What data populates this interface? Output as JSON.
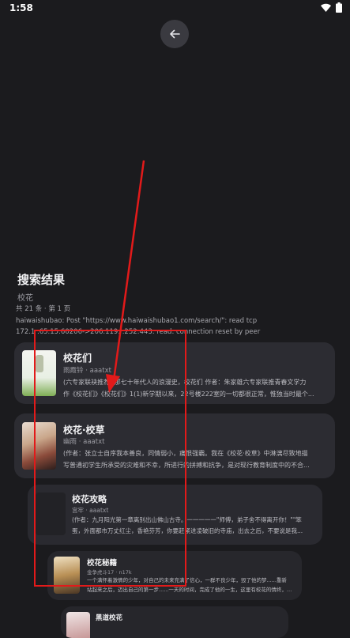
{
  "status": {
    "time": "1:58"
  },
  "header": {
    "title": "搜索结果",
    "keyword": "校花"
  },
  "meta": "共 21 条 · 第 1 页",
  "error_lines": [
    "haiwaishubao: Post \"https://www.haiwaishubao1.com/search/\": read tcp",
    "172.1  .65.15:60206->206.119.  .252:443: read: connection reset by peer"
  ],
  "results": [
    {
      "title": "校花们",
      "author": "雨霞铃 · aaatxt",
      "desc": [
        "(六专家联袂推荐) 那七十年代人的浪漫史，校花们 作者：朱家雄六专家联推青春文学力",
        "作《校花们》《校花们》1(1)新学期以来，22号楼222室的一切都很正常，惟独当时最个..."
      ]
    },
    {
      "title": "校花·校草",
      "author": "幽雨 · aaatxt",
      "desc": [
        "(作者：张立士自序我本善良，同情弱小，痛恨强霸。我在《校花·校草》中淋漓尽致地描",
        "写普通初学生所承受的灾难和不幸，所进行的拼搏和抗争，是对现行教育制度中的不合..."
      ]
    },
    {
      "title": "校花攻略",
      "author": "宫牢 · aaatxt",
      "desc": [
        "(作者：九月阳光第一章离别出山佛山古寺。一一一一一\"师傅，弟子舍不得离开你！\"\"笨",
        "蛋，外面都市万丈红尘，香艳芬芳，你要赶紧进凌破旧的寺庙，出去之后，不要说是我..."
      ]
    },
    {
      "title": "校花秘籍",
      "author": "金争虎斗17 · n17k",
      "desc": [
        "一个满怀着激情的少年，对自己的未来充满了信心，一群不良少年，毁了他的梦......重新",
        "站起来之后，迈出自己的第一步......一天的时间，完成了他的一生，这里有校花的情终，有..."
      ]
    },
    {
      "title": "黑道校花",
      "author": "",
      "desc": []
    }
  ],
  "annotation": {
    "color": "#e21a1a"
  }
}
